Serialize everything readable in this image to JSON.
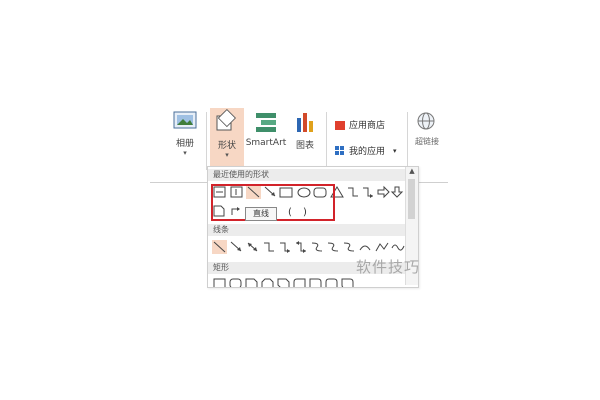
{
  "ribbon": {
    "album_label": "相册",
    "shapes_label": "形状",
    "smartart_label": "SmartArt",
    "chart_label": "图表",
    "app_store_label": "应用商店",
    "my_apps_label": "我的应用",
    "hyperlink_label": "超链接"
  },
  "gallery": {
    "recent_header": "最近使用的形状",
    "lines_header": "线条",
    "rect_header": "矩形"
  },
  "tooltip": "直线",
  "watermark": "软件技巧",
  "colors": {
    "accent_red": "#d2232a",
    "store_red": "#e0402e",
    "apps_blue": "#2f6fc2",
    "shapes_highlight": "#f7d7c4"
  }
}
